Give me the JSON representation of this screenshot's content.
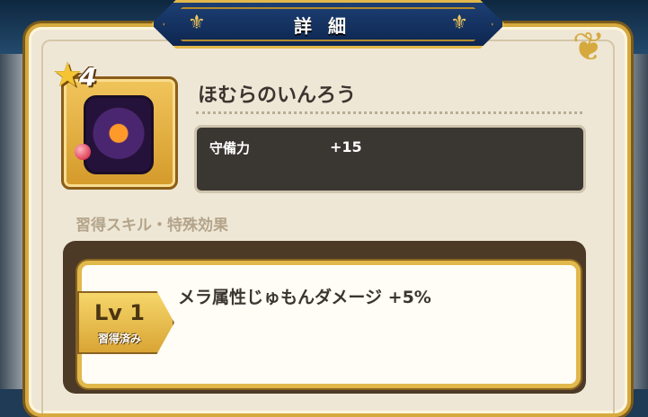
{
  "dialog": {
    "title": "詳細"
  },
  "item": {
    "name": "ほむらのいんろう",
    "rarity": "4",
    "stat_label": "守備力",
    "stat_value": "+15"
  },
  "skills": {
    "section_title": "習得スキル・特殊効果",
    "entries": [
      {
        "level": "Lv 1",
        "status": "習得済み",
        "text": "メラ属性じゅもんダメージ +5%"
      }
    ]
  },
  "icons": {
    "item_icon": "purple-inro-with-flame-icon",
    "rarity": "star-icon",
    "ornament": "fleur-de-lis-icon"
  },
  "colors": {
    "banner": "#0e2650",
    "gold": "#d6a93f",
    "panel": "#efe7d6",
    "stat_box": "#3a3632"
  }
}
